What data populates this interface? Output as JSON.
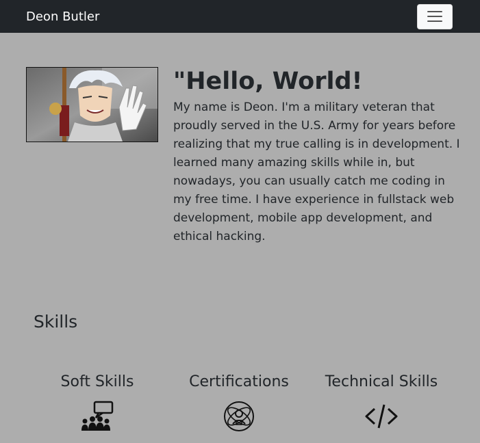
{
  "nav": {
    "brand": "Deon Butler",
    "menu_icon": "hamburger-menu-icon"
  },
  "hero": {
    "image_icon": "anime-character-portrait",
    "heading": "\"Hello, World!",
    "bio": "My name is Deon. I'm a military veteran that proudly served in the U.S. Army for years before realizing that my true calling is in development. I learned many amazing skills while in, but nowadays, you can usually catch me coding in my free time. I have experience in fullstack web development, mobile app development, and ethical hacking."
  },
  "skills": {
    "title": "Skills",
    "items": [
      {
        "label": "Soft Skills",
        "icon": "team-speech-icon"
      },
      {
        "label": "Certifications",
        "icon": "certification-person-icon"
      },
      {
        "label": "Technical Skills",
        "icon": "code-brackets-icon"
      }
    ]
  },
  "colors": {
    "navbar": "#212529",
    "background": "#adadad",
    "text": "#212529"
  }
}
